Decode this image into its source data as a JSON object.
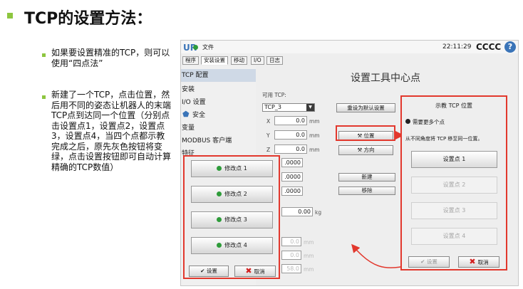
{
  "slide": {
    "title": "TCP的设置方法：",
    "bullets": [
      "如果要设置精准的TCP，则可以使用“四点法”",
      "新建了一个TCP，点击位置，然后用不同的姿态让机器人的末端TCP点到达同一个位置（分别点击设置点1，设置点2，设置点3，设置点4，当四个点都示教完成之后，原先灰色按钮将变绿，点击设置按钮即可自动计算精确的TCP数值）"
    ]
  },
  "ur": {
    "logo": "UR",
    "file_menu": "文件",
    "time": "22:11:29",
    "robot_name": "CCCC",
    "help": "?",
    "tabs": [
      "程序",
      "安装设置",
      "移动",
      "I/O",
      "日志"
    ],
    "sidebar": [
      "TCP 配置",
      "安装",
      "I/O 设置",
      "安全",
      "变量",
      "MODBUS 客户端",
      "特征"
    ],
    "heading": "设置工具中心点",
    "available_tcp_label": "可用 TCP:",
    "tcp_selected": "TCP_3",
    "reset_default_button": "重设为默认设置",
    "position_button": "位置",
    "orientation_button": "方向",
    "new_button": "新建",
    "remove_button": "移除",
    "axes": [
      {
        "label": "X",
        "value": "0.0",
        "unit": "mm"
      },
      {
        "label": "Y",
        "value": "0.0",
        "unit": "mm"
      },
      {
        "label": "Z",
        "value": "0.0",
        "unit": "mm"
      }
    ],
    "rot_values": [
      ".0000",
      ".0000",
      ".0000"
    ],
    "payload_value": "0.00",
    "payload_unit": "kg",
    "cog_values": [
      {
        "value": "0.0",
        "unit": "mm"
      },
      {
        "value": "0.0",
        "unit": "mm"
      },
      {
        "value": "58.0",
        "unit": "mm"
      }
    ]
  },
  "teach_panel": {
    "title": "示教 TCP 位置",
    "need_more": "需要更多个点",
    "instruction": "从不同角度将 TCP 移至同一位置。",
    "points": [
      "设置点 1",
      "设置点 2",
      "设置点 3",
      "设置点 4"
    ],
    "set_button": "设置",
    "cancel_button": "取消"
  },
  "modify_panel": {
    "points": [
      "修改点 1",
      "修改点 2",
      "修改点 3",
      "修改点 4"
    ],
    "set_button": "设置",
    "cancel_button": "取消"
  },
  "colors": {
    "accent_green": "#8dc63f",
    "annotation_red": "#e2382d",
    "status_green": "#2e9c3a",
    "ur_blue": "#3a74b8"
  }
}
